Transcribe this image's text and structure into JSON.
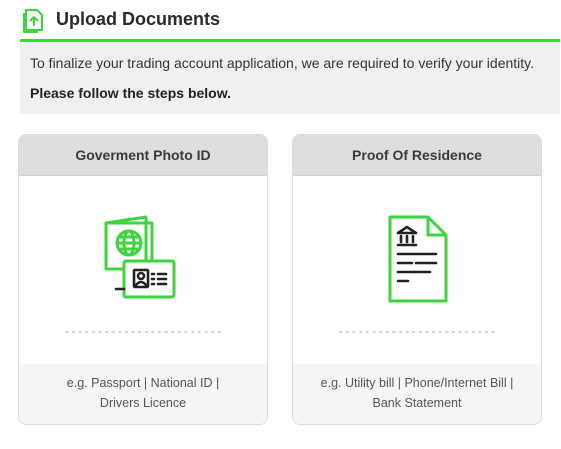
{
  "header": {
    "title": "Upload Documents",
    "icon": "upload-file-icon"
  },
  "info": {
    "line1": "To finalize your trading account application, we are required to verify your identity.",
    "line2": "Please follow the steps below."
  },
  "cards": [
    {
      "title": "Goverment Photo ID",
      "icon": "passport-id-icon",
      "dashes": "------------------------",
      "examples_line1": "e.g. Passport | National ID |",
      "examples_line2": "Drivers Licence"
    },
    {
      "title": "Proof Of Residence",
      "icon": "bank-statement-icon",
      "dashes": "------------------------",
      "examples_line1": "e.g. Utility bill | Phone/Internet Bill |",
      "examples_line2": "Bank Statement"
    }
  ],
  "colors": {
    "accent": "#3fd43f",
    "card_header": "#dedede",
    "info_bg": "#f0f0f0"
  }
}
